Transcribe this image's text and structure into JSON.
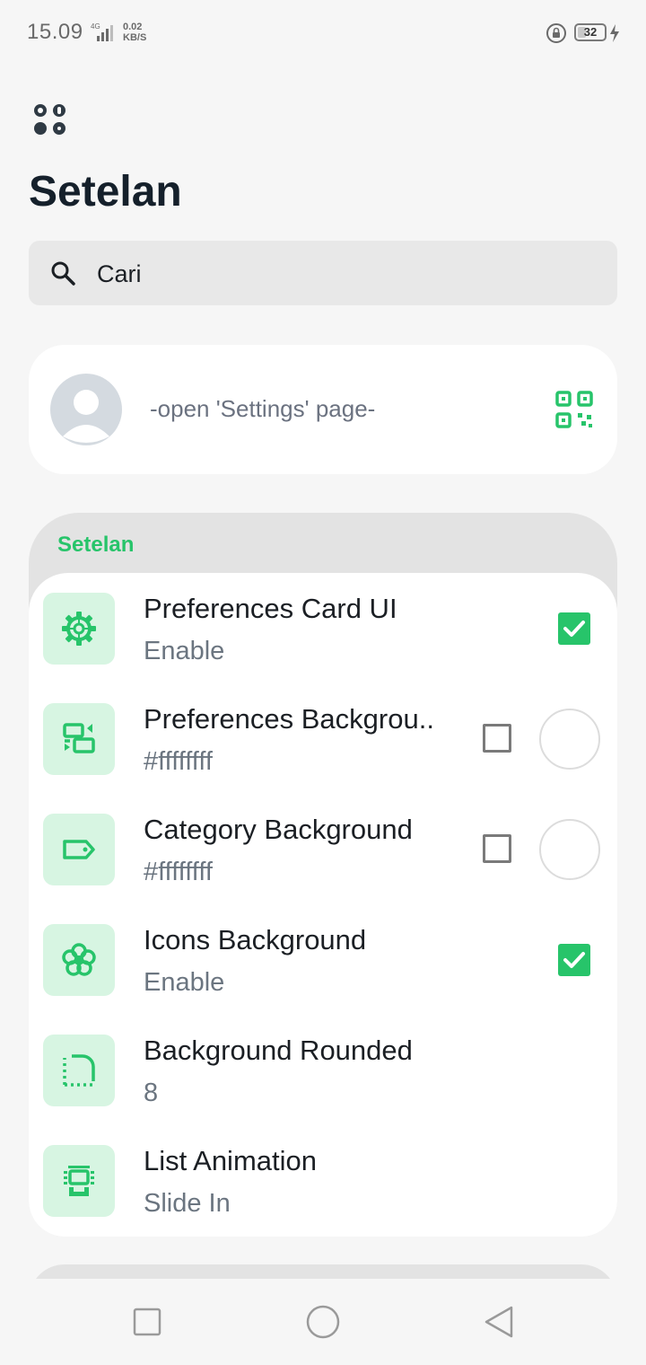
{
  "status_bar": {
    "time": "15.09",
    "network_type": "4G",
    "data_rate_value": "0.02",
    "data_rate_unit": "KB/S",
    "battery_level": "32",
    "battery_fraction": 0.32
  },
  "page": {
    "title": "Setelan"
  },
  "search": {
    "placeholder": "Cari"
  },
  "profile": {
    "text": "-open 'Settings' page-"
  },
  "section": {
    "title": "Setelan",
    "items": [
      {
        "title": "Preferences Card UI",
        "subtitle": "Enable",
        "icon": "gear-icon",
        "control": "checkbox",
        "checked": true
      },
      {
        "title": "Preferences Backgrou..",
        "subtitle": "#ffffffff",
        "icon": "background-layers-icon",
        "control": "checkbox-color",
        "checked": false,
        "color": "#ffffff"
      },
      {
        "title": "Category Background",
        "subtitle": "#ffffffff",
        "icon": "label-tag-icon",
        "control": "checkbox-color",
        "checked": false,
        "color": "#ffffff"
      },
      {
        "title": "Icons Background",
        "subtitle": "Enable",
        "icon": "flower-icon",
        "control": "checkbox",
        "checked": true
      },
      {
        "title": "Background Rounded",
        "subtitle": "8",
        "icon": "rounded-corner-icon",
        "control": "none"
      },
      {
        "title": "List Animation",
        "subtitle": "Slide In",
        "icon": "animation-icon",
        "control": "none"
      }
    ]
  },
  "colors": {
    "accent": "#27c46a",
    "icon_tile": "#d7f5e2",
    "background": "#f6f6f6",
    "card": "#ffffff"
  },
  "nav_bar": {
    "buttons": [
      "recent-apps-button",
      "home-button",
      "back-button"
    ]
  }
}
